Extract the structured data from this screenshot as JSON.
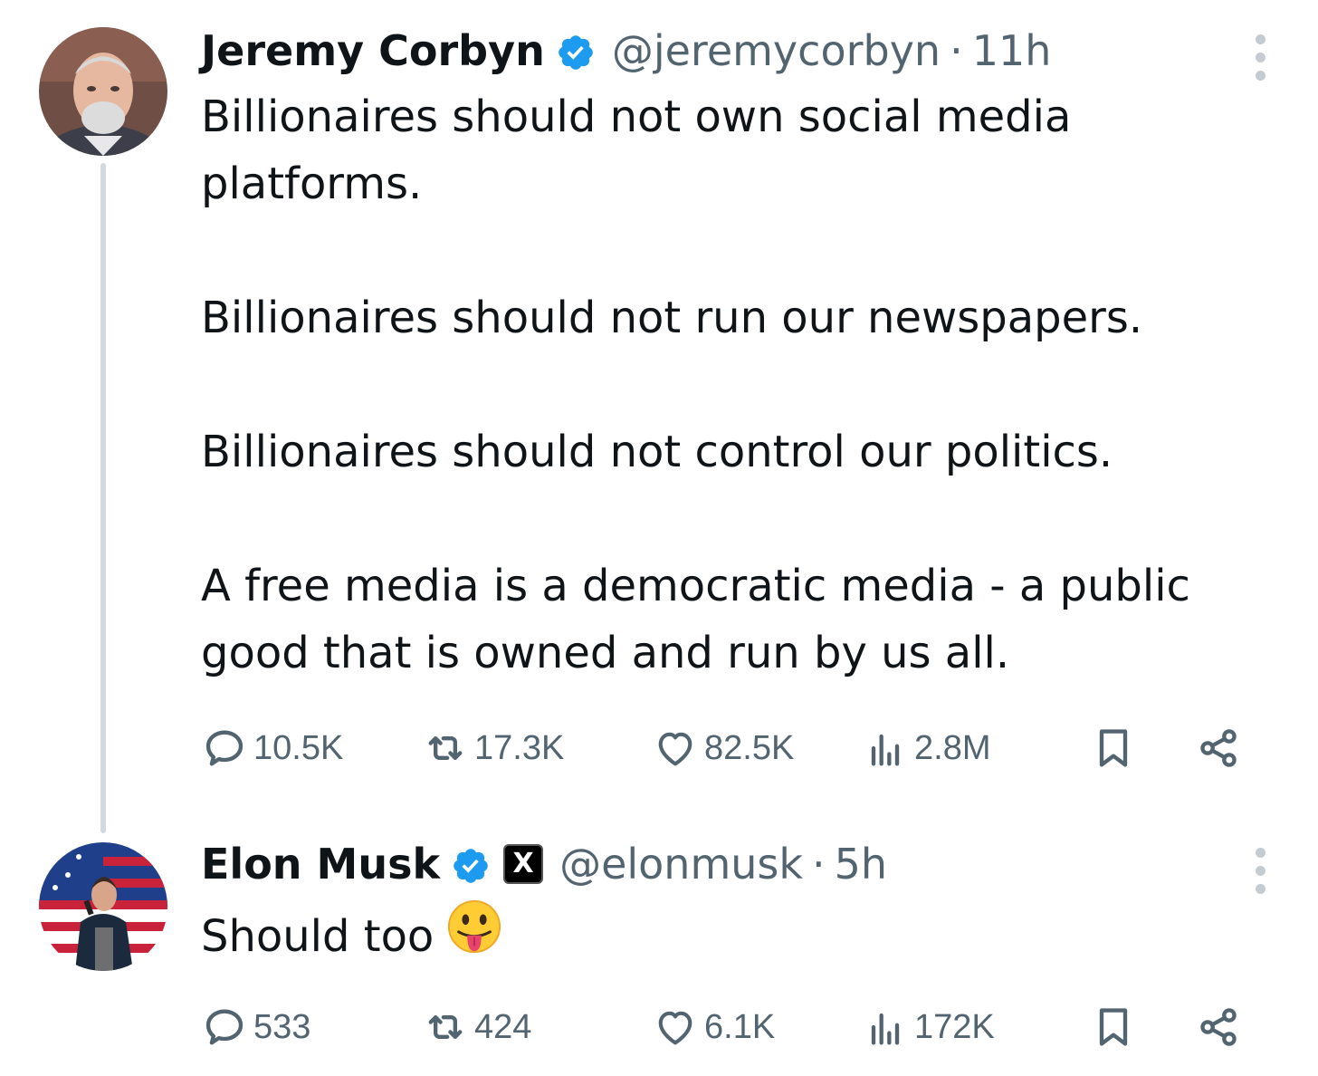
{
  "tweets": [
    {
      "author": "Jeremy Corbyn",
      "handle": "@jeremycorbyn",
      "separator": "·",
      "time": "11h",
      "paragraphs": [
        "Billionaires should not own social media platforms.",
        "Billionaires should not run our newspapers.",
        "Billionaires should not control our politics.",
        "A free media is a democratic media - a public good that is owned and run by us all."
      ],
      "stats": {
        "replies": "10.5K",
        "reposts": "17.3K",
        "likes": "82.5K",
        "views": "2.8M"
      }
    },
    {
      "author": "Elon Musk",
      "handle": "@elonmusk",
      "separator": "·",
      "time": "5h",
      "text": "Should too",
      "emoji": "face-with-tongue",
      "affiliate_badge": "X",
      "stats": {
        "replies": "533",
        "reposts": "424",
        "likes": "6.1K",
        "views": "172K"
      }
    }
  ],
  "icons": {
    "verified": "verified-badge-icon",
    "reply": "reply-icon",
    "repost": "repost-icon",
    "like": "heart-icon",
    "views": "views-icon",
    "bookmark": "bookmark-icon",
    "share": "share-icon",
    "more": "more-icon"
  },
  "colors": {
    "text": "#0f1419",
    "secondary": "#536471",
    "verified": "#1d9bf0",
    "thread_line": "#cfd9de"
  }
}
